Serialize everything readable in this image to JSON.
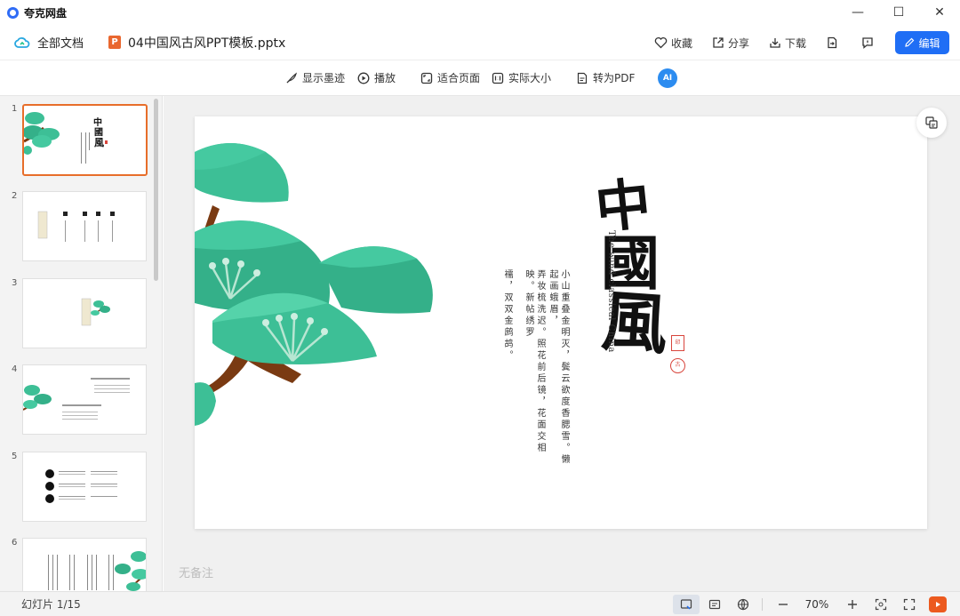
{
  "window": {
    "app_name": "夸克网盘",
    "controls": {
      "minimize": "—",
      "maximize": "☐",
      "close": "✕"
    }
  },
  "docbar": {
    "all_docs_label": "全部文档",
    "file_name": "04中国风古风PPT模板.pptx",
    "file_icon_letter": "P",
    "actions": {
      "favorite": "收藏",
      "share": "分享",
      "download": "下载",
      "edit": "编辑"
    }
  },
  "toolbar": {
    "show_ink": "显示墨迹",
    "play": "播放",
    "fit_page": "适合页面",
    "actual_size": "实际大小",
    "to_pdf": "转为PDF",
    "ai_label": "AI"
  },
  "thumbnails": [
    {
      "number": "1",
      "active": true
    },
    {
      "number": "2",
      "active": false
    },
    {
      "number": "3",
      "active": false
    },
    {
      "number": "4",
      "active": false
    },
    {
      "number": "5",
      "active": false
    },
    {
      "number": "6",
      "active": false
    }
  ],
  "slide": {
    "calligraphy": [
      "中",
      "國",
      "風"
    ],
    "subtitle": "The wind classical China",
    "seal_1": "印",
    "seal_2": "古",
    "poem_lines": [
      "小山重叠金明灭，鬓云欲度香腮雪。懒起画蛾眉，",
      "弄妆梳洗迟。照花前后镜，花面交相映。新帖绣罗",
      "襦，双双金鹧鸪。"
    ]
  },
  "notes_placeholder": "无备注",
  "status": {
    "slide_count": "幻灯片 1/15",
    "zoom": "70%"
  },
  "colors": {
    "accent": "#1f6ef5",
    "pine_green": "#3dbf96",
    "trunk": "#7a3a12",
    "active_thumb_border": "#e76e2a"
  }
}
